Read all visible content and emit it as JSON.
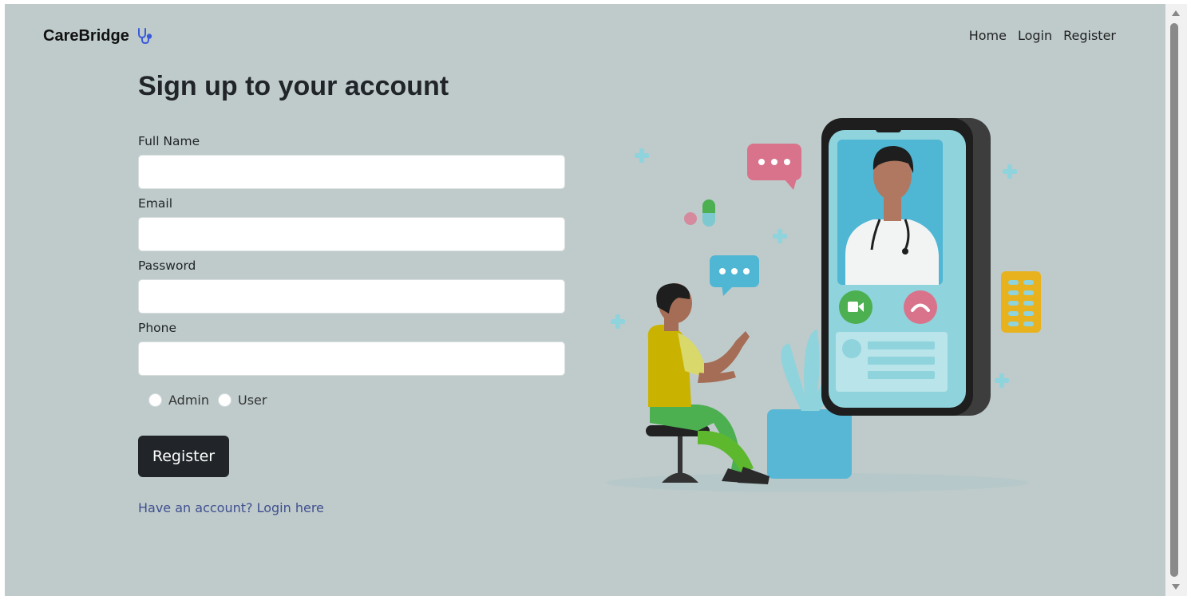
{
  "brand": {
    "name": "CareBridge",
    "icon": "stethoscope-icon"
  },
  "nav": {
    "items": [
      "Home",
      "Login",
      "Register"
    ]
  },
  "form": {
    "title": "Sign up to your account",
    "fields": [
      {
        "label": "Full Name",
        "value": "",
        "placeholder": ""
      },
      {
        "label": "Email",
        "value": "",
        "placeholder": ""
      },
      {
        "label": "Password",
        "value": "",
        "placeholder": ""
      },
      {
        "label": "Phone",
        "value": "",
        "placeholder": ""
      }
    ],
    "roles": [
      "Admin",
      "User"
    ],
    "submit_label": "Register",
    "login_link": "Have an account? Login here"
  },
  "colors": {
    "page_background": "#bfcbcb",
    "button_background": "#212529",
    "link_color": "#3f4f8f"
  }
}
